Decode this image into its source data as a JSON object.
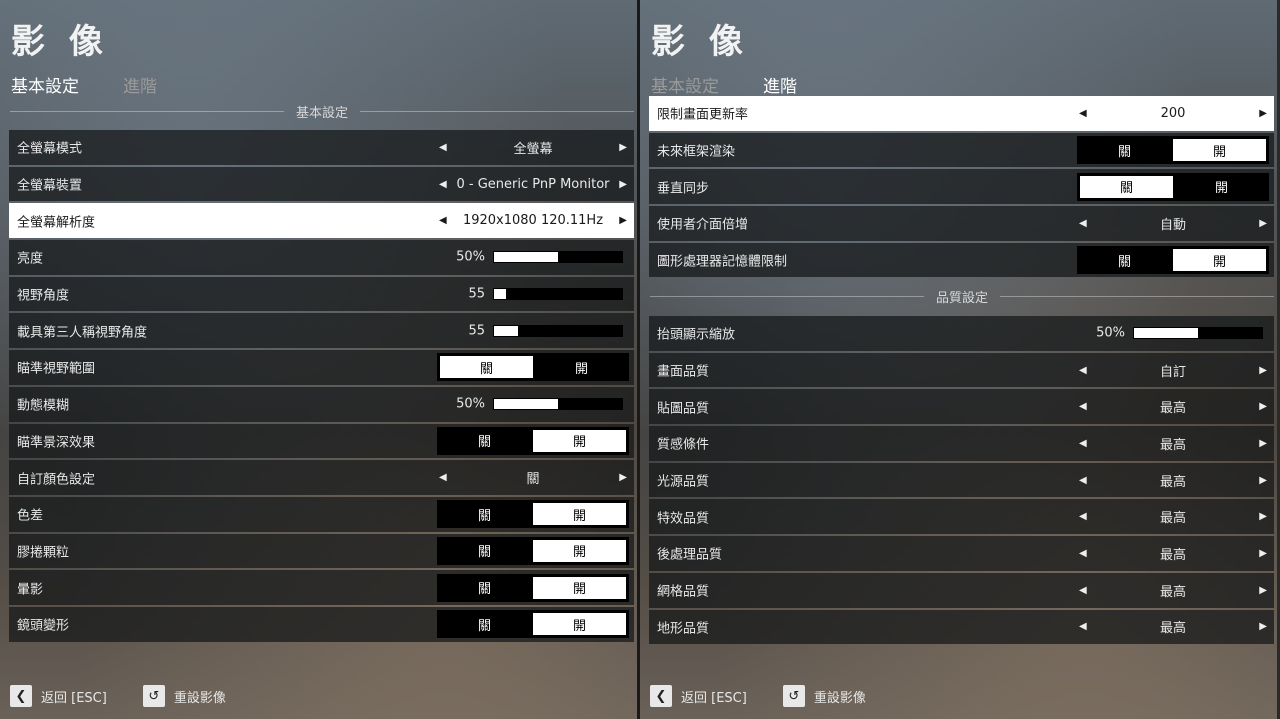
{
  "left": {
    "title": "影 像",
    "tabs": [
      {
        "label": "基本設定",
        "active": true
      },
      {
        "label": "進階",
        "active": false
      }
    ],
    "section_label": "基本設定",
    "rows": [
      {
        "label": "全螢幕模式",
        "type": "selector",
        "value": "全螢幕"
      },
      {
        "label": "全螢幕裝置",
        "type": "selector",
        "value": "0 - Generic PnP Monitor"
      },
      {
        "label": "全螢幕解析度",
        "type": "selector",
        "value": "1920x1080 120.11Hz",
        "highlighted": true
      },
      {
        "label": "亮度",
        "type": "slider",
        "value": "50%",
        "fraction": 0.5
      },
      {
        "label": "視野角度",
        "type": "slider",
        "value": "55",
        "fraction": 0.09
      },
      {
        "label": "載具第三人稱視野角度",
        "type": "slider",
        "value": "55",
        "fraction": 0.19
      },
      {
        "label": "瞄準視野範圍",
        "type": "toggle",
        "off_label": "關",
        "on_label": "開",
        "state": "off"
      },
      {
        "label": "動態模糊",
        "type": "slider",
        "value": "50%",
        "fraction": 0.5
      },
      {
        "label": "瞄準景深效果",
        "type": "toggle",
        "off_label": "關",
        "on_label": "開",
        "state": "on"
      },
      {
        "label": "自訂顏色設定",
        "type": "selector",
        "value": "關"
      },
      {
        "label": "色差",
        "type": "toggle",
        "off_label": "關",
        "on_label": "開",
        "state": "on"
      },
      {
        "label": "膠捲顆粒",
        "type": "toggle",
        "off_label": "關",
        "on_label": "開",
        "state": "on"
      },
      {
        "label": "暈影",
        "type": "toggle",
        "off_label": "關",
        "on_label": "開",
        "state": "on"
      },
      {
        "label": "鏡頭變形",
        "type": "toggle",
        "off_label": "關",
        "on_label": "開",
        "state": "on"
      }
    ],
    "footer": {
      "back_label": "返回 [ESC]",
      "reset_label": "重設影像"
    }
  },
  "right": {
    "title": "影 像",
    "tabs": [
      {
        "label": "基本設定",
        "active": false
      },
      {
        "label": "進階",
        "active": true
      }
    ],
    "rows_top": [
      {
        "label": "限制畫面更新率",
        "type": "selector",
        "value": "200",
        "highlighted": true
      },
      {
        "label": "未來框架渲染",
        "type": "toggle",
        "off_label": "關",
        "on_label": "開",
        "state": "on"
      },
      {
        "label": "垂直同步",
        "type": "toggle",
        "off_label": "關",
        "on_label": "開",
        "state": "off"
      },
      {
        "label": "使用者介面倍增",
        "type": "selector",
        "value": "自動"
      },
      {
        "label": "圖形處理器記憶體限制",
        "type": "toggle",
        "off_label": "關",
        "on_label": "開",
        "state": "on"
      }
    ],
    "section_label": "品質設定",
    "rows_bottom": [
      {
        "label": "抬頭顯示縮放",
        "type": "slider",
        "value": "50%",
        "fraction": 0.5
      },
      {
        "label": "畫面品質",
        "type": "selector",
        "value": "自訂"
      },
      {
        "label": "貼圖品質",
        "type": "selector",
        "value": "最高"
      },
      {
        "label": "質感條件",
        "type": "selector",
        "value": "最高"
      },
      {
        "label": "光源品質",
        "type": "selector",
        "value": "最高"
      },
      {
        "label": "特效品質",
        "type": "selector",
        "value": "最高"
      },
      {
        "label": "後處理品質",
        "type": "selector",
        "value": "最高"
      },
      {
        "label": "網格品質",
        "type": "selector",
        "value": "最高"
      },
      {
        "label": "地形品質",
        "type": "selector",
        "value": "最高"
      }
    ],
    "footer": {
      "back_label": "返回 [ESC]",
      "reset_label": "重設影像"
    }
  },
  "colors": {
    "row_bg": "#141618",
    "highlight": "#ffffff",
    "toggle_on": "#ffffff",
    "toggle_off": "#000000"
  },
  "icons": {
    "back": "chevron-left-icon",
    "reset": "reset-icon",
    "arrow_left": "triangle-left-icon",
    "arrow_right": "triangle-right-icon"
  }
}
